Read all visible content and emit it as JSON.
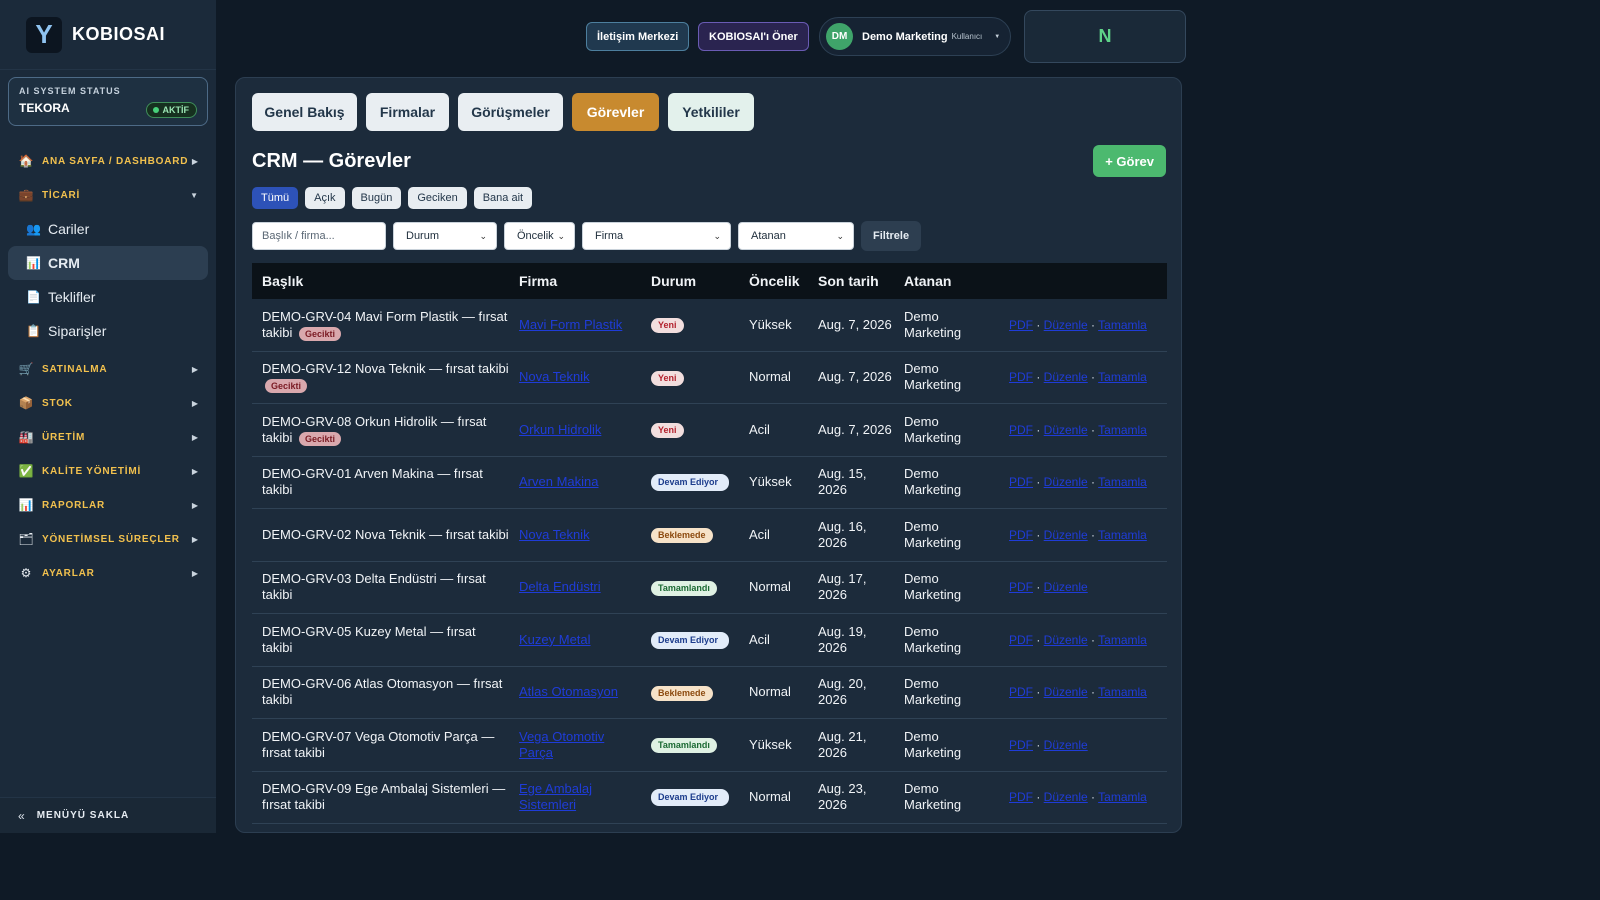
{
  "brand": {
    "logo": "Y",
    "name": "KOBIOSAI"
  },
  "status_card": {
    "label": "AI SYSTEM STATUS",
    "name": "TEKORA",
    "badge": "AKTİF"
  },
  "nav": {
    "dashboard": "ANA SAYFA / DASHBOARD",
    "ticari": "TİCARİ",
    "cariler": "Cariler",
    "crm": "CRM",
    "teklifler": "Teklifler",
    "siparisler": "Siparişler",
    "satinalma": "SATINALMA",
    "stok": "STOK",
    "uretim": "ÜRETİM",
    "kalite": "KALİTE YÖNETİMİ",
    "raporlar": "RAPORLAR",
    "yonetimsel": "YÖNETİMSEL SÜREÇLER",
    "ayarlar": "AYARLAR",
    "collapse": "MENÜYÜ SAKLA"
  },
  "topbar": {
    "iletisim": "İletişim Merkezi",
    "oner": "KOBIOSAI'ı Öner",
    "user_initials": "DM",
    "user_name": "Demo Marketing",
    "user_role": "Kullanıcı",
    "n_box": "N"
  },
  "tabs": [
    "Genel Bakış",
    "Firmalar",
    "Görüşmeler",
    "Görevler",
    "Yetkililer"
  ],
  "page_title": "CRM — Görevler",
  "add_button": "+ Görev",
  "chips": [
    "Tümü",
    "Açık",
    "Bugün",
    "Geciken",
    "Bana ait"
  ],
  "filters": {
    "search_placeholder": "Başlık / firma...",
    "durum": "Durum",
    "oncelik": "Öncelik",
    "firma": "Firma",
    "atanan": "Atanan",
    "button": "Filtrele"
  },
  "table": {
    "headers": [
      "Başlık",
      "Firma",
      "Durum",
      "Öncelik",
      "Son tarih",
      "Atanan"
    ],
    "late_label": "Gecikti",
    "action_pdf": "PDF",
    "action_edit": "Düzenle",
    "action_complete": "Tamamla",
    "rows": [
      {
        "title": "DEMO-GRV-04 Mavi Form Plastik — fırsat takibi",
        "firma": "Mavi Form Plastik",
        "durum": "Yeni",
        "oncelik": "Yüksek",
        "tarih": "Aug. 7, 2026",
        "atanan": "Demo Marketing"
      },
      {
        "title": "DEMO-GRV-12 Nova Teknik — fırsat takibi",
        "firma": "Nova Teknik",
        "durum": "Yeni",
        "oncelik": "Normal",
        "tarih": "Aug. 7, 2026",
        "atanan": "Demo Marketing"
      },
      {
        "title": "DEMO-GRV-08 Orkun Hidrolik — fırsat takibi",
        "firma": "Orkun Hidrolik",
        "durum": "Yeni",
        "oncelik": "Acil",
        "tarih": "Aug. 7, 2026",
        "atanan": "Demo Marketing"
      },
      {
        "title": "DEMO-GRV-01 Arven Makina — fırsat takibi",
        "firma": "Arven Makina",
        "durum": "Devam Ediyor",
        "oncelik": "Yüksek",
        "tarih": "Aug. 15, 2026",
        "atanan": "Demo Marketing"
      },
      {
        "title": "DEMO-GRV-02 Nova Teknik — fırsat takibi",
        "firma": "Nova Teknik",
        "durum": "Beklemede",
        "oncelik": "Acil",
        "tarih": "Aug. 16, 2026",
        "atanan": "Demo Marketing"
      },
      {
        "title": "DEMO-GRV-03 Delta Endüstri — fırsat takibi",
        "firma": "Delta Endüstri",
        "durum": "Tamamlandı",
        "oncelik": "Normal",
        "tarih": "Aug. 17, 2026",
        "atanan": "Demo Marketing"
      },
      {
        "title": "DEMO-GRV-05 Kuzey Metal — fırsat takibi",
        "firma": "Kuzey Metal",
        "durum": "Devam Ediyor",
        "oncelik": "Acil",
        "tarih": "Aug. 19, 2026",
        "atanan": "Demo Marketing"
      },
      {
        "title": "DEMO-GRV-06 Atlas Otomasyon — fırsat takibi",
        "firma": "Atlas Otomasyon",
        "durum": "Beklemede",
        "oncelik": "Normal",
        "tarih": "Aug. 20, 2026",
        "atanan": "Demo Marketing"
      },
      {
        "title": "DEMO-GRV-07 Vega Otomotiv Parça — fırsat takibi",
        "firma": "Vega Otomotiv Parça",
        "durum": "Tamamlandı",
        "oncelik": "Yüksek",
        "tarih": "Aug. 21, 2026",
        "atanan": "Demo Marketing"
      },
      {
        "title": "DEMO-GRV-09 Ege Ambalaj Sistemleri — fırsat takibi",
        "firma": "Ege Ambalaj Sistemleri",
        "durum": "Devam Ediyor",
        "oncelik": "Normal",
        "tarih": "Aug. 23, 2026",
        "atanan": "Demo Marketing"
      }
    ]
  }
}
